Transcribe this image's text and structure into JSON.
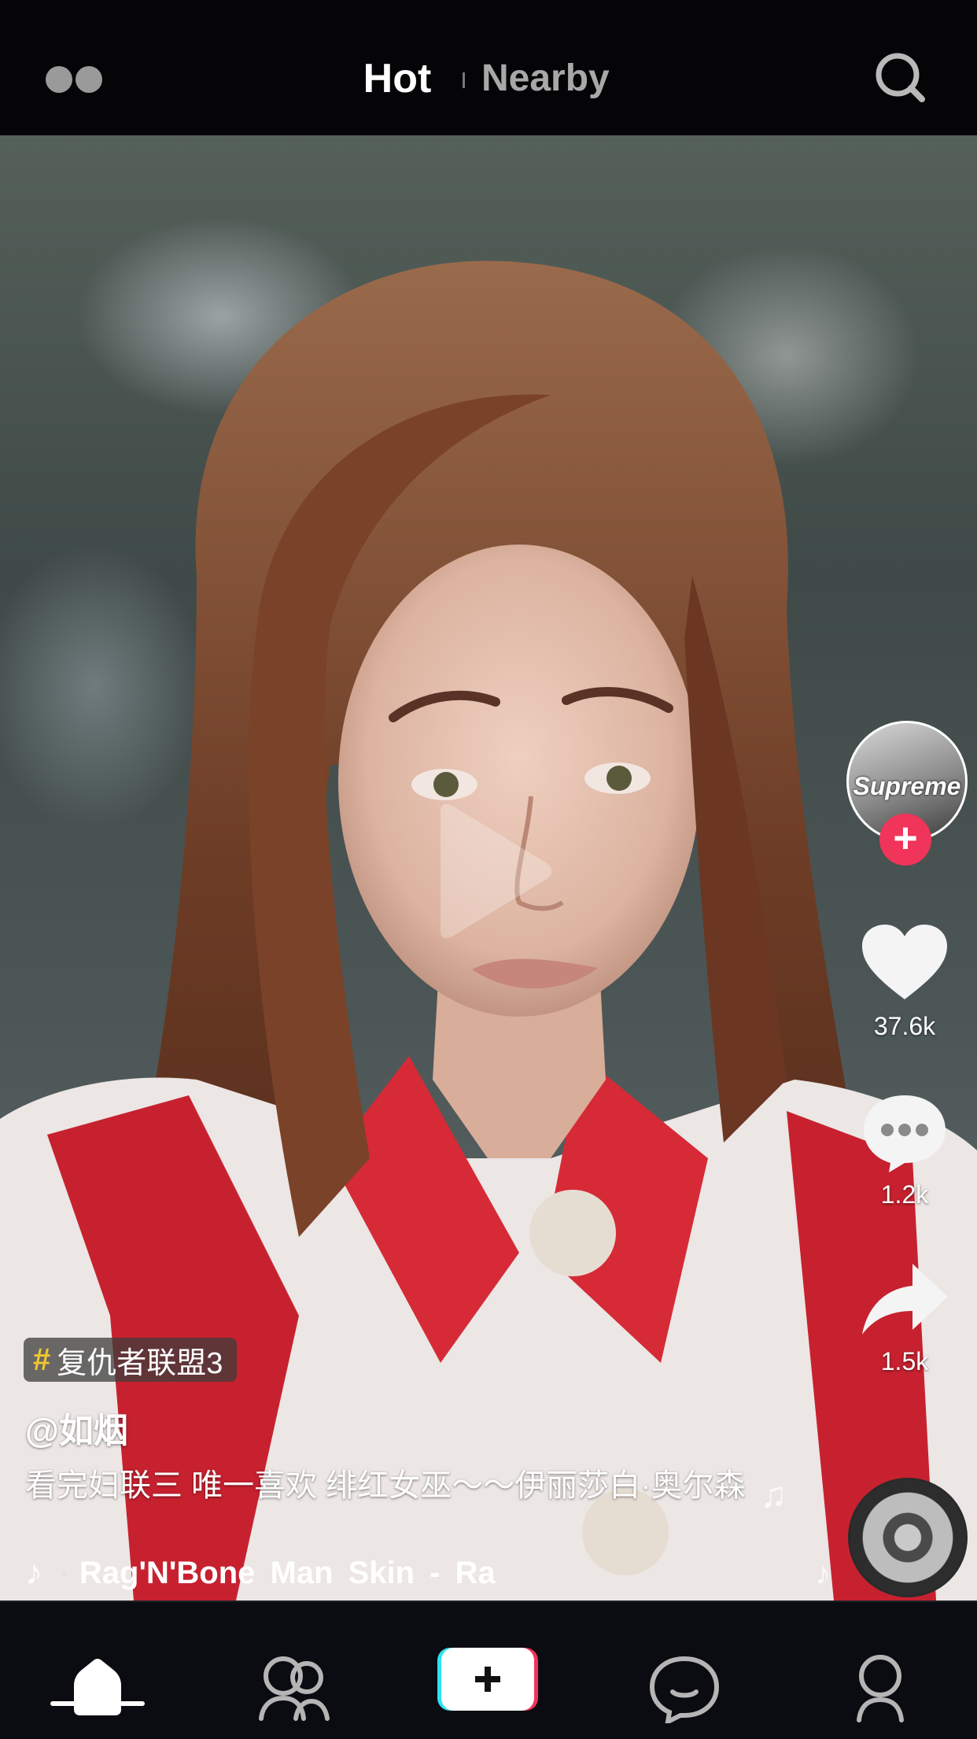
{
  "header": {
    "tabs": [
      {
        "label": "Hot",
        "active": true
      },
      {
        "label": "Nearby",
        "active": false
      }
    ],
    "menu_icon": "dots-icon",
    "search_icon": "search-icon"
  },
  "creator": {
    "avatar_label": "Supreme",
    "follow_label": "+"
  },
  "actions": {
    "likes": "37.6k",
    "comments": "1.2k",
    "shares": "1.5k"
  },
  "post": {
    "hashtag_symbol": "#",
    "hashtag": "复仇者联盟3",
    "username": "@如烟",
    "caption": "看完妇联三 唯一喜欢 绯红女巫～～伊丽莎白·奥尔森",
    "music_note": "♪",
    "music_separator": "·",
    "music": "Rag'N'Bone Man    Skin - Ra"
  },
  "colors": {
    "accent_red": "#f0345a",
    "hashtag_yellow": "#f1c62d"
  },
  "bottom_nav": [
    "home-icon",
    "friends-icon",
    "create-icon",
    "messages-icon",
    "profile-icon"
  ]
}
